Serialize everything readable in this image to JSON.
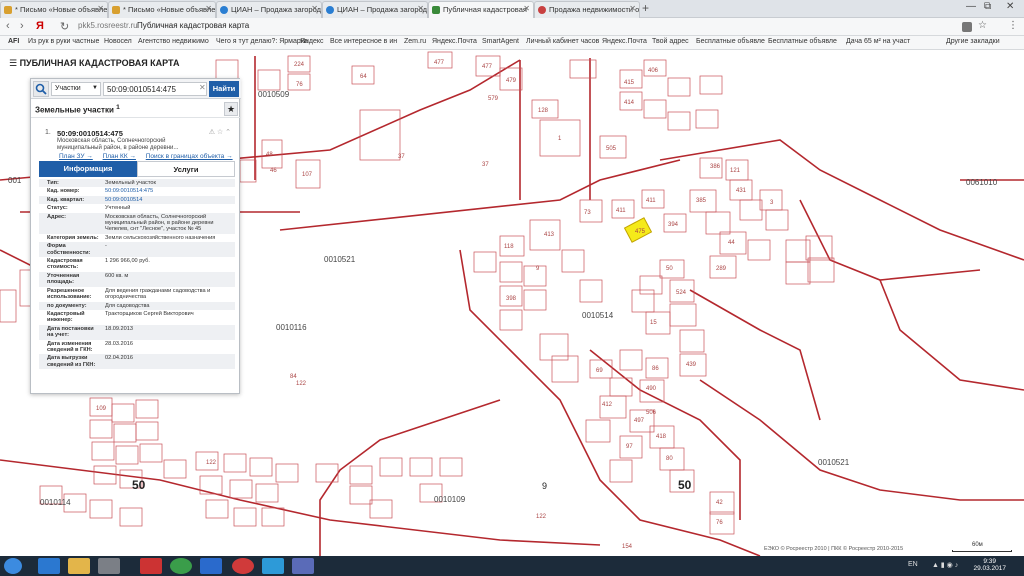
{
  "browser": {
    "tabs": [
      {
        "label": "* Письмо «Новые объявле",
        "color": "#d8a030"
      },
      {
        "label": "* Письмо «Новые объявле",
        "color": "#d8a030"
      },
      {
        "label": "ЦИАН – Продажа загород",
        "color": "#2a7ed2"
      },
      {
        "label": "ЦИАН – Продажа загород",
        "color": "#2a7ed2"
      },
      {
        "label": "Публичная кадастровая",
        "color": "#3a8a3a"
      },
      {
        "label": "Продажа недвижимости от",
        "color": "#c84040"
      }
    ],
    "address": {
      "url": "pkk5.rosreestr.ru",
      "title": "Публичная кадастровая карта",
      "yandex": "Я"
    },
    "bookmarks": [
      "Из рук в руки частные",
      "Новосел",
      "Агентство недвижимо",
      "Чего я тут делаю?: Ярмарка",
      "Яндекс",
      "Все интересное в ин",
      "Zem.ru",
      "Яндекс.Почта",
      "SmartAgent",
      "Личный кабинет часов",
      "Яндекс.Почта",
      "Твой адрес",
      "Бесплатные объявле",
      "Бесплатные объявле",
      "Дача 65 м² на участ"
    ],
    "bookmarks_other": "Другие закладки",
    "apps_label": "AFI"
  },
  "map": {
    "header": "ПУБЛИЧНАЯ КАДАСТРОВАЯ КАРТА",
    "quarters": [
      "0010509",
      "0010521",
      "0010116",
      "0010514",
      "0010114",
      "0010109",
      "0010521",
      "0061010",
      "001"
    ],
    "big_labels": [
      "50",
      "50",
      "9"
    ],
    "parcel_numbers": [
      "224",
      "64",
      "477",
      "76",
      "477",
      "479",
      "128",
      "579",
      "1",
      "415",
      "406",
      "414",
      "505",
      "48",
      "107",
      "37",
      "37",
      "413",
      "411",
      "73",
      "118",
      "9",
      "386",
      "394",
      "411",
      "385",
      "431",
      "121",
      "3",
      "44",
      "398",
      "50",
      "524",
      "289",
      "15",
      "46",
      "122",
      "84",
      "109",
      "412",
      "490",
      "497",
      "69",
      "86",
      "506",
      "418",
      "439",
      "97",
      "80",
      "122",
      "154",
      "122",
      "76",
      "42"
    ],
    "highlighted_parcel": "475"
  },
  "panel": {
    "search": {
      "select_value": "Участки",
      "input_value": "50:09:0010514:475",
      "button_label": "Найти"
    },
    "section_title": "Земельные участки",
    "section_count": "1",
    "result": {
      "index": "1.",
      "cad_number": "50:09:0010514:475",
      "address": "Московская область, Солнечногорский муниципальный район, в районе деревни...",
      "links": [
        "План ЗУ →",
        "План КК →",
        "Поиск в границах объекта →"
      ]
    },
    "tabs": [
      "Информация",
      "Услуги"
    ],
    "attributes": [
      {
        "k": "Тип:",
        "v": "Земельный участок"
      },
      {
        "k": "Кад. номер:",
        "v": "50:09:0010514:475",
        "link": true
      },
      {
        "k": "Кад. квартал:",
        "v": "50:09:0010514",
        "link": true
      },
      {
        "k": "Статус:",
        "v": "Учтенный"
      },
      {
        "k": "Адрес:",
        "v": "Московская область, Солнечногорский муниципальный район, в районе деревни Чепелев, снт \"Лесное\", участок № 45"
      },
      {
        "k": "Категория земель:",
        "v": "Земли сельскохозяйственного назначения"
      },
      {
        "k": "Форма собственности:",
        "v": "-"
      },
      {
        "k": "Кадастровая стоимость:",
        "v": "1 296 966,00 руб."
      },
      {
        "k": "Уточненная площадь:",
        "v": "600 кв. м"
      },
      {
        "k": "Разрешенное использование:",
        "v": "Для ведения гражданами садоводства и огородничества"
      },
      {
        "k": "по документу:",
        "v": "Для садоводства"
      },
      {
        "k": "Кадастровый инженер:",
        "v": "Тракторщиков Сергей Викторович"
      },
      {
        "k": "Дата постановки на учет:",
        "v": "18.09.2013"
      },
      {
        "k": "Дата изменения сведений в ГКН:",
        "v": "28.03.2016"
      },
      {
        "k": "Дата выгрузки сведений из ГКН:",
        "v": "02.04.2016"
      }
    ]
  },
  "attribution": "ЕЭКО © Росреестр 2010 | ПКК © Росреестр 2010-2015",
  "scale": "60м",
  "taskbar": {
    "lang": "EN",
    "time": "9:39",
    "date": "29.03.2017"
  }
}
